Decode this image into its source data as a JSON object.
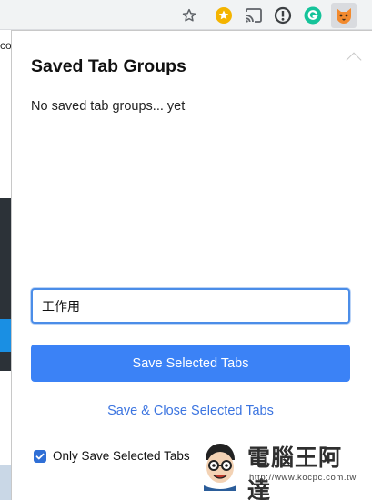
{
  "toolbar": {
    "icons": [
      "star-icon",
      "notification-extension-icon",
      "cast-icon",
      "info-extension-icon",
      "grammarly-icon",
      "tab-groups-extension-icon"
    ]
  },
  "background_page": {
    "edge_text": "co"
  },
  "popup": {
    "title": "Saved Tab Groups",
    "empty_message": "No saved tab groups... yet",
    "name_input_value": "工作用",
    "save_button_label": "Save Selected Tabs",
    "save_close_label": "Save & Close Selected Tabs",
    "only_selected_label": "Only Save Selected Tabs",
    "only_selected_checked": true
  },
  "watermark": {
    "text": "電腦王阿達",
    "url": "http://www.kocpc.com.tw"
  },
  "colors": {
    "primary": "#3b82f6",
    "link": "#3b74e0",
    "input_focus": "#4b8de8"
  }
}
